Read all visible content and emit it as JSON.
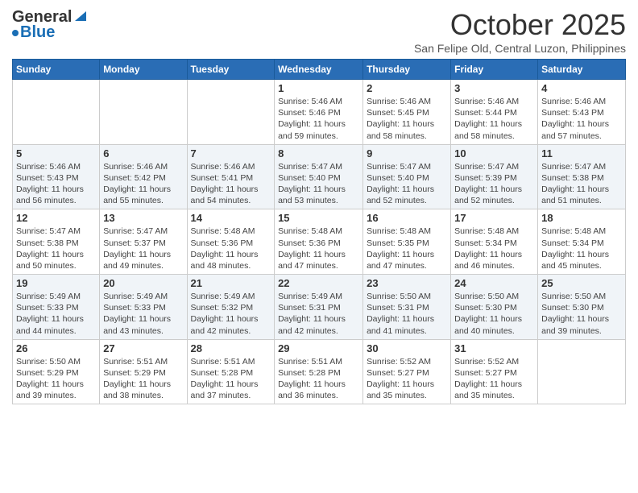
{
  "logo": {
    "general": "General",
    "blue": "Blue"
  },
  "title": "October 2025",
  "subtitle": "San Felipe Old, Central Luzon, Philippines",
  "days_of_week": [
    "Sunday",
    "Monday",
    "Tuesday",
    "Wednesday",
    "Thursday",
    "Friday",
    "Saturday"
  ],
  "weeks": [
    [
      {
        "day": "",
        "info": ""
      },
      {
        "day": "",
        "info": ""
      },
      {
        "day": "",
        "info": ""
      },
      {
        "day": "1",
        "info": "Sunrise: 5:46 AM\nSunset: 5:46 PM\nDaylight: 11 hours and 59 minutes."
      },
      {
        "day": "2",
        "info": "Sunrise: 5:46 AM\nSunset: 5:45 PM\nDaylight: 11 hours and 58 minutes."
      },
      {
        "day": "3",
        "info": "Sunrise: 5:46 AM\nSunset: 5:44 PM\nDaylight: 11 hours and 58 minutes."
      },
      {
        "day": "4",
        "info": "Sunrise: 5:46 AM\nSunset: 5:43 PM\nDaylight: 11 hours and 57 minutes."
      }
    ],
    [
      {
        "day": "5",
        "info": "Sunrise: 5:46 AM\nSunset: 5:43 PM\nDaylight: 11 hours and 56 minutes."
      },
      {
        "day": "6",
        "info": "Sunrise: 5:46 AM\nSunset: 5:42 PM\nDaylight: 11 hours and 55 minutes."
      },
      {
        "day": "7",
        "info": "Sunrise: 5:46 AM\nSunset: 5:41 PM\nDaylight: 11 hours and 54 minutes."
      },
      {
        "day": "8",
        "info": "Sunrise: 5:47 AM\nSunset: 5:40 PM\nDaylight: 11 hours and 53 minutes."
      },
      {
        "day": "9",
        "info": "Sunrise: 5:47 AM\nSunset: 5:40 PM\nDaylight: 11 hours and 52 minutes."
      },
      {
        "day": "10",
        "info": "Sunrise: 5:47 AM\nSunset: 5:39 PM\nDaylight: 11 hours and 52 minutes."
      },
      {
        "day": "11",
        "info": "Sunrise: 5:47 AM\nSunset: 5:38 PM\nDaylight: 11 hours and 51 minutes."
      }
    ],
    [
      {
        "day": "12",
        "info": "Sunrise: 5:47 AM\nSunset: 5:38 PM\nDaylight: 11 hours and 50 minutes."
      },
      {
        "day": "13",
        "info": "Sunrise: 5:47 AM\nSunset: 5:37 PM\nDaylight: 11 hours and 49 minutes."
      },
      {
        "day": "14",
        "info": "Sunrise: 5:48 AM\nSunset: 5:36 PM\nDaylight: 11 hours and 48 minutes."
      },
      {
        "day": "15",
        "info": "Sunrise: 5:48 AM\nSunset: 5:36 PM\nDaylight: 11 hours and 47 minutes."
      },
      {
        "day": "16",
        "info": "Sunrise: 5:48 AM\nSunset: 5:35 PM\nDaylight: 11 hours and 47 minutes."
      },
      {
        "day": "17",
        "info": "Sunrise: 5:48 AM\nSunset: 5:34 PM\nDaylight: 11 hours and 46 minutes."
      },
      {
        "day": "18",
        "info": "Sunrise: 5:48 AM\nSunset: 5:34 PM\nDaylight: 11 hours and 45 minutes."
      }
    ],
    [
      {
        "day": "19",
        "info": "Sunrise: 5:49 AM\nSunset: 5:33 PM\nDaylight: 11 hours and 44 minutes."
      },
      {
        "day": "20",
        "info": "Sunrise: 5:49 AM\nSunset: 5:33 PM\nDaylight: 11 hours and 43 minutes."
      },
      {
        "day": "21",
        "info": "Sunrise: 5:49 AM\nSunset: 5:32 PM\nDaylight: 11 hours and 42 minutes."
      },
      {
        "day": "22",
        "info": "Sunrise: 5:49 AM\nSunset: 5:31 PM\nDaylight: 11 hours and 42 minutes."
      },
      {
        "day": "23",
        "info": "Sunrise: 5:50 AM\nSunset: 5:31 PM\nDaylight: 11 hours and 41 minutes."
      },
      {
        "day": "24",
        "info": "Sunrise: 5:50 AM\nSunset: 5:30 PM\nDaylight: 11 hours and 40 minutes."
      },
      {
        "day": "25",
        "info": "Sunrise: 5:50 AM\nSunset: 5:30 PM\nDaylight: 11 hours and 39 minutes."
      }
    ],
    [
      {
        "day": "26",
        "info": "Sunrise: 5:50 AM\nSunset: 5:29 PM\nDaylight: 11 hours and 39 minutes."
      },
      {
        "day": "27",
        "info": "Sunrise: 5:51 AM\nSunset: 5:29 PM\nDaylight: 11 hours and 38 minutes."
      },
      {
        "day": "28",
        "info": "Sunrise: 5:51 AM\nSunset: 5:28 PM\nDaylight: 11 hours and 37 minutes."
      },
      {
        "day": "29",
        "info": "Sunrise: 5:51 AM\nSunset: 5:28 PM\nDaylight: 11 hours and 36 minutes."
      },
      {
        "day": "30",
        "info": "Sunrise: 5:52 AM\nSunset: 5:27 PM\nDaylight: 11 hours and 35 minutes."
      },
      {
        "day": "31",
        "info": "Sunrise: 5:52 AM\nSunset: 5:27 PM\nDaylight: 11 hours and 35 minutes."
      },
      {
        "day": "",
        "info": ""
      }
    ]
  ]
}
